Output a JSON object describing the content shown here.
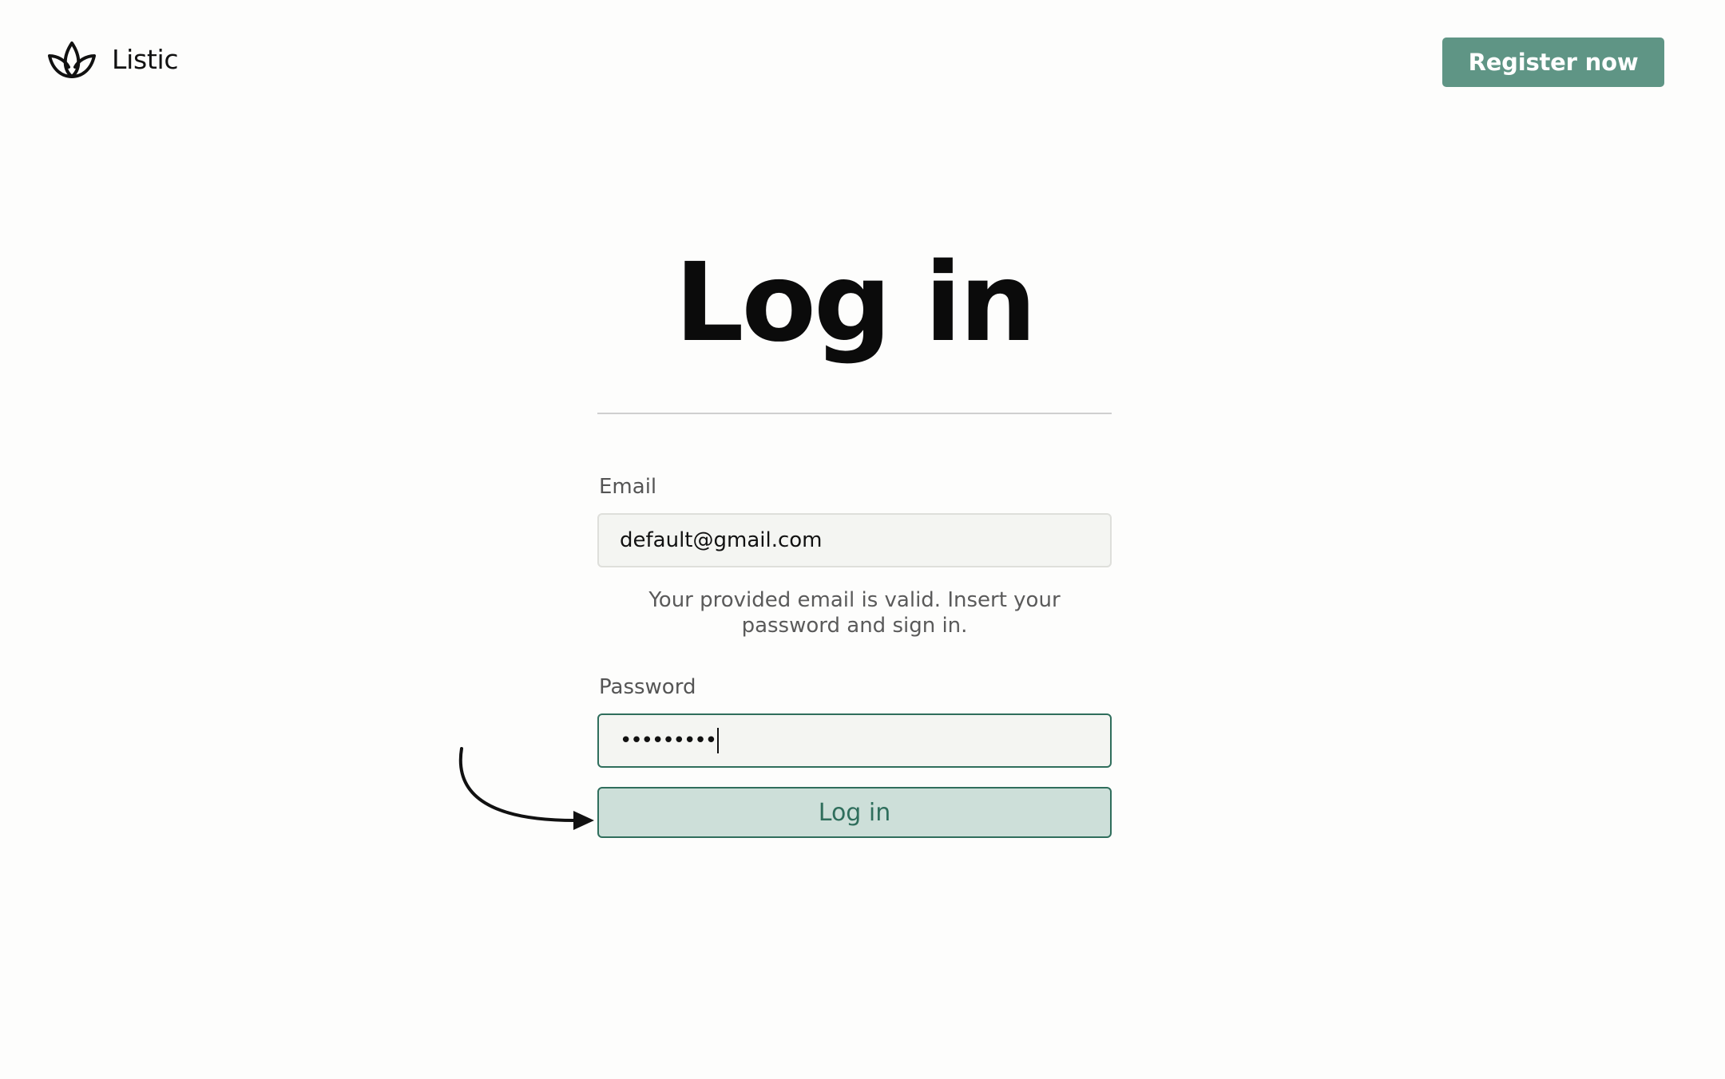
{
  "header": {
    "brand_name": "Listic",
    "logo_icon": "lotus-icon",
    "register_label": "Register now"
  },
  "main": {
    "title": "Log in",
    "email": {
      "label": "Email",
      "value": "default@gmail.com"
    },
    "helper_text": "Your provided email is valid. Insert your password and sign in.",
    "password": {
      "label": "Password",
      "masked_value": "•••••••••"
    },
    "submit_label": "Log in"
  },
  "colors": {
    "accent": "#5f9585",
    "accent_dark": "#2f6e5c",
    "button_bg": "#cddfd9",
    "input_bg": "#f4f5f2",
    "page_bg": "#fdfdfc"
  },
  "annotation": {
    "icon": "curved-arrow-icon"
  }
}
